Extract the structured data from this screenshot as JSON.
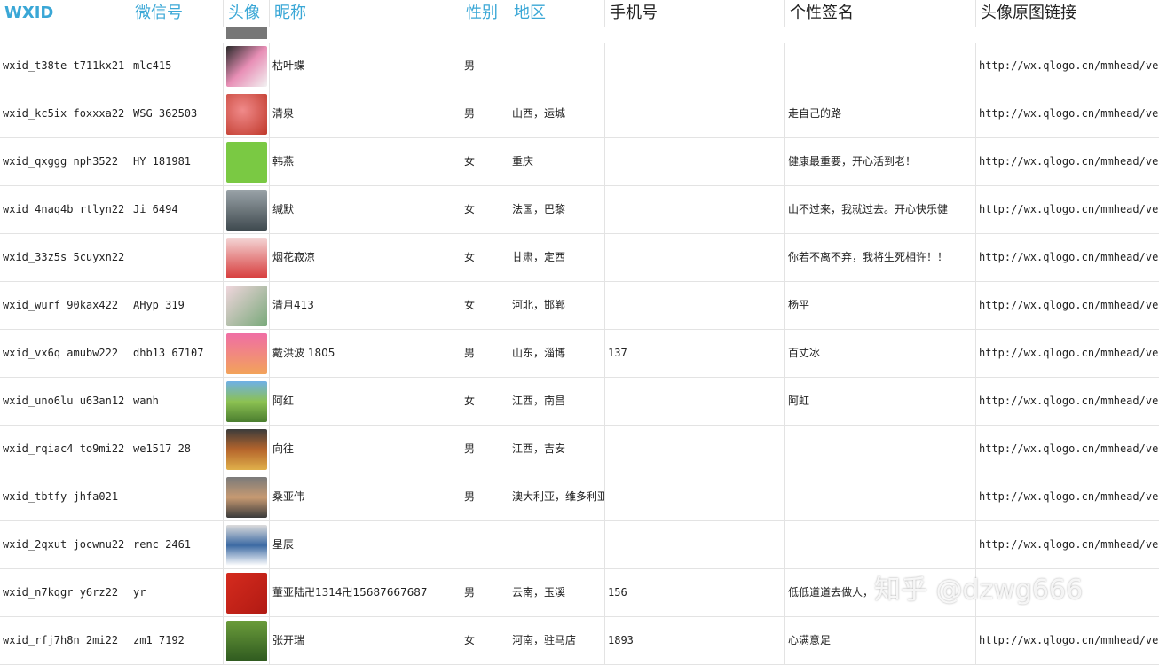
{
  "header": {
    "cols": [
      "WXID",
      "微信号",
      "头像",
      "昵称",
      "性别",
      "地区",
      "手机号",
      "个性签名",
      "头像原图链接"
    ]
  },
  "colors": {
    "accent": "#3aa7d6",
    "text": "#222222",
    "grid": "#e3e3e3"
  },
  "rows": [
    {
      "wxid": "wxid_t38te  t711kx21",
      "wx": "mlc415",
      "nick": "枯叶蝶",
      "gender": "男",
      "region": "",
      "phone": "",
      "sign": "",
      "url": "http://wx.qlogo.cn/mmhead/ver"
    },
    {
      "wxid": "wxid_kc5ix  foxxxa22",
      "wx": "WSG  362503",
      "nick": "清泉",
      "gender": "男",
      "region": "山西，运城",
      "phone": "",
      "sign": "走自己的路",
      "url": "http://wx.qlogo.cn/mmhead/ver"
    },
    {
      "wxid": "wxid_qxggg  nph3522",
      "wx": "HY  181981",
      "nick": "韩燕",
      "gender": "女",
      "region": "重庆",
      "phone": "",
      "sign": "健康最重要，开心活到老！",
      "url": "http://wx.qlogo.cn/mmhead/ver"
    },
    {
      "wxid": "wxid_4naq4b  rtlyn22",
      "wx": "Ji    6494",
      "nick": "缄默",
      "gender": "女",
      "region": "法国，巴黎",
      "phone": "",
      "sign": "山不过来，我就过去。开心快乐健",
      "url": "http://wx.qlogo.cn/mmhead/ver"
    },
    {
      "wxid": "wxid_33z5s  5cuyxn22",
      "wx": "",
      "nick": "烟花寂凉",
      "gender": "女",
      "region": "甘肃，定西",
      "phone": "",
      "sign": "你若不离不弃，我将生死相许！！",
      "url": "http://wx.qlogo.cn/mmhead/ver"
    },
    {
      "wxid": "wxid_wurf  90kax422",
      "wx": "AHyp  319",
      "nick": "清月413",
      "gender": "女",
      "region": "河北，邯郸",
      "phone": "",
      "sign": "杨平",
      "url": "http://wx.qlogo.cn/mmhead/ver"
    },
    {
      "wxid": "wxid_vx6q  amubw222",
      "wx": "dhb13  67107",
      "nick": "戴洪波  1805",
      "gender": "男",
      "region": "山东，淄博",
      "phone": "137",
      "sign": "百丈冰",
      "url": "http://wx.qlogo.cn/mmhead/ver"
    },
    {
      "wxid": "wxid_uno6lu  u63an12",
      "wx": "wanh",
      "nick": "阿红",
      "gender": "女",
      "region": "江西，南昌",
      "phone": "",
      "sign": "阿虹",
      "url": "http://wx.qlogo.cn/mmhead/ver"
    },
    {
      "wxid": "wxid_rqiac4  to9mi22",
      "wx": "we1517  28",
      "nick": "向往",
      "gender": "男",
      "region": "江西，吉安",
      "phone": "",
      "sign": "",
      "url": "http://wx.qlogo.cn/mmhead/ver"
    },
    {
      "wxid": "wxid_tbtfy  jhfa021",
      "wx": "",
      "nick": "桑亚伟",
      "gender": "男",
      "region": "澳大利亚，维多利亚，墨尔本",
      "phone": "",
      "sign": "",
      "url": "http://wx.qlogo.cn/mmhead/ver"
    },
    {
      "wxid": "wxid_2qxut  jocwnu22",
      "wx": "renc  2461",
      "nick": "星辰",
      "gender": "",
      "region": "",
      "phone": "",
      "sign": "",
      "url": "http://wx.qlogo.cn/mmhead/ver"
    },
    {
      "wxid": "wxid_n7kqgr  y6rz22",
      "wx": "yr",
      "nick": "董亚陆卍1314卍15687667687",
      "gender": "男",
      "region": "云南，玉溪",
      "phone": "156",
      "sign": "低低道道去做人，",
      "url": ""
    },
    {
      "wxid": "wxid_rfj7h8n  2mi22",
      "wx": "zm1  7192",
      "nick": "张开瑞",
      "gender": "女",
      "region": "河南，驻马店",
      "phone": "1893",
      "sign": "心满意足",
      "url": "http://wx.qlogo.cn/mmhead/ver"
    }
  ],
  "watermark": "知乎 @dzwg666"
}
